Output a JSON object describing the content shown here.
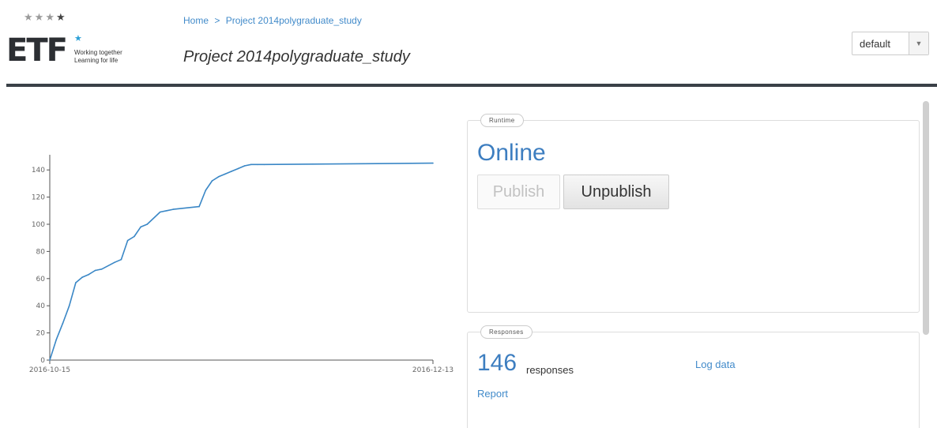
{
  "logo": {
    "text": "ETF",
    "tagline_line1": "Working together",
    "tagline_line2": "Learning for life"
  },
  "breadcrumb": {
    "home": "Home",
    "separator": ">",
    "current": "Project 2014polygraduate_study"
  },
  "page_title": "Project 2014polygraduate_study",
  "language_select": {
    "value": "default"
  },
  "colors": {
    "accent": "#3d7ec0",
    "line": "#3a87c6",
    "header_rule": "#3a4047"
  },
  "chart_data": {
    "type": "line",
    "title": "",
    "xlabel": "",
    "ylabel": "",
    "ylim": [
      0,
      150
    ],
    "yticks": [
      0,
      20,
      40,
      60,
      80,
      100,
      120,
      140
    ],
    "xlim": [
      "2016-10-15",
      "2016-12-13"
    ],
    "xtick_labels": [
      "2016-10-15",
      "2016-12-13"
    ],
    "x": [
      "2016-10-15",
      "2016-10-16",
      "2016-10-17",
      "2016-10-18",
      "2016-10-19",
      "2016-10-20",
      "2016-10-21",
      "2016-10-22",
      "2016-10-23",
      "2016-10-25",
      "2016-10-26",
      "2016-10-27",
      "2016-10-28",
      "2016-10-29",
      "2016-10-30",
      "2016-11-01",
      "2016-11-02",
      "2016-11-03",
      "2016-11-07",
      "2016-11-08",
      "2016-11-09",
      "2016-11-10",
      "2016-11-11",
      "2016-11-12",
      "2016-11-13",
      "2016-11-14",
      "2016-11-15",
      "2016-11-16",
      "2016-11-17",
      "2016-12-13"
    ],
    "values": [
      0,
      15,
      27,
      40,
      57,
      61,
      63,
      66,
      67,
      72,
      74,
      88,
      91,
      98,
      100,
      109,
      110,
      111,
      113,
      125,
      132,
      135,
      137,
      139,
      141,
      143,
      144,
      144,
      144,
      145
    ]
  },
  "runtime": {
    "legend": "Runtime",
    "status": "Online",
    "publish_label": "Publish",
    "unpublish_label": "Unpublish"
  },
  "responses": {
    "legend": "Responses",
    "count": "146",
    "count_label": "responses",
    "log_data_label": "Log data",
    "report_label": "Report"
  }
}
